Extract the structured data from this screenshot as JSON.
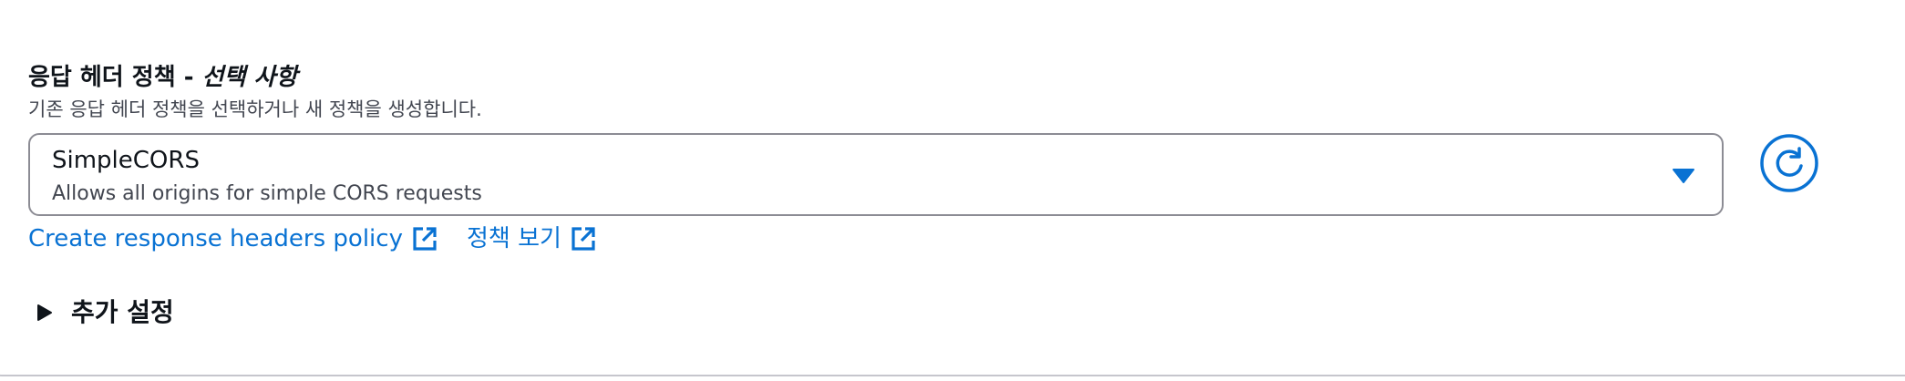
{
  "field": {
    "label": "응답 헤더 정책",
    "separator": "-",
    "optional": "선택 사항",
    "description": "기존 응답 헤더 정책을 선택하거나 새 정책을 생성합니다."
  },
  "select": {
    "selected_title": "SimpleCORS",
    "selected_description": "Allows all origins for simple CORS requests",
    "caret_icon": "caret-down-icon"
  },
  "refresh": {
    "icon": "refresh-icon"
  },
  "links": {
    "create_policy": "Create response headers policy",
    "view_policy": "정책 보기",
    "icon": "external-link-icon"
  },
  "expander": {
    "label": "추가 설정",
    "icon": "caret-right-icon",
    "expanded": false
  },
  "colors": {
    "link": "#0972d3",
    "text": "#0f141a",
    "secondary_text": "#424650",
    "border": "#8c8c94"
  }
}
